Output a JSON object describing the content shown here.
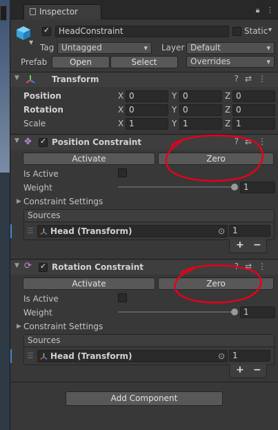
{
  "tab": {
    "title": "Inspector"
  },
  "object": {
    "name": "HeadConstraint",
    "static_label": "Static",
    "tag_label": "Tag",
    "tag_value": "Untagged",
    "layer_label": "Layer",
    "layer_value": "Default",
    "prefab_label": "Prefab",
    "open": "Open",
    "select": "Select",
    "overrides": "Overrides"
  },
  "transform": {
    "title": "Transform",
    "position": "Position",
    "rotation": "Rotation",
    "scale": "Scale",
    "pos": [
      "0",
      "0",
      "0"
    ],
    "rot": [
      "0",
      "0",
      "0"
    ],
    "scl": [
      "1",
      "1",
      "1"
    ],
    "axes": [
      "X",
      "Y",
      "Z"
    ]
  },
  "position_constraint": {
    "title": "Position Constraint",
    "activate": "Activate",
    "zero": "Zero",
    "is_active": "Is Active",
    "weight": "Weight",
    "weight_value": "1",
    "weight_fraction": 1.0,
    "settings": "Constraint Settings",
    "sources": "Sources",
    "source_name": "Head (Transform)",
    "source_weight": "1"
  },
  "rotation_constraint": {
    "title": "Rotation Constraint",
    "activate": "Activate",
    "zero": "Zero",
    "is_active": "Is Active",
    "weight": "Weight",
    "weight_value": "1",
    "weight_fraction": 1.0,
    "settings": "Constraint Settings",
    "sources": "Sources",
    "source_name": "Head (Transform)",
    "source_weight": "1"
  },
  "add_component": "Add Component",
  "controls": {
    "plus": "+",
    "minus": "−"
  },
  "colors": {
    "annotation": "#e8001a",
    "accent": "#4a8bd6"
  }
}
